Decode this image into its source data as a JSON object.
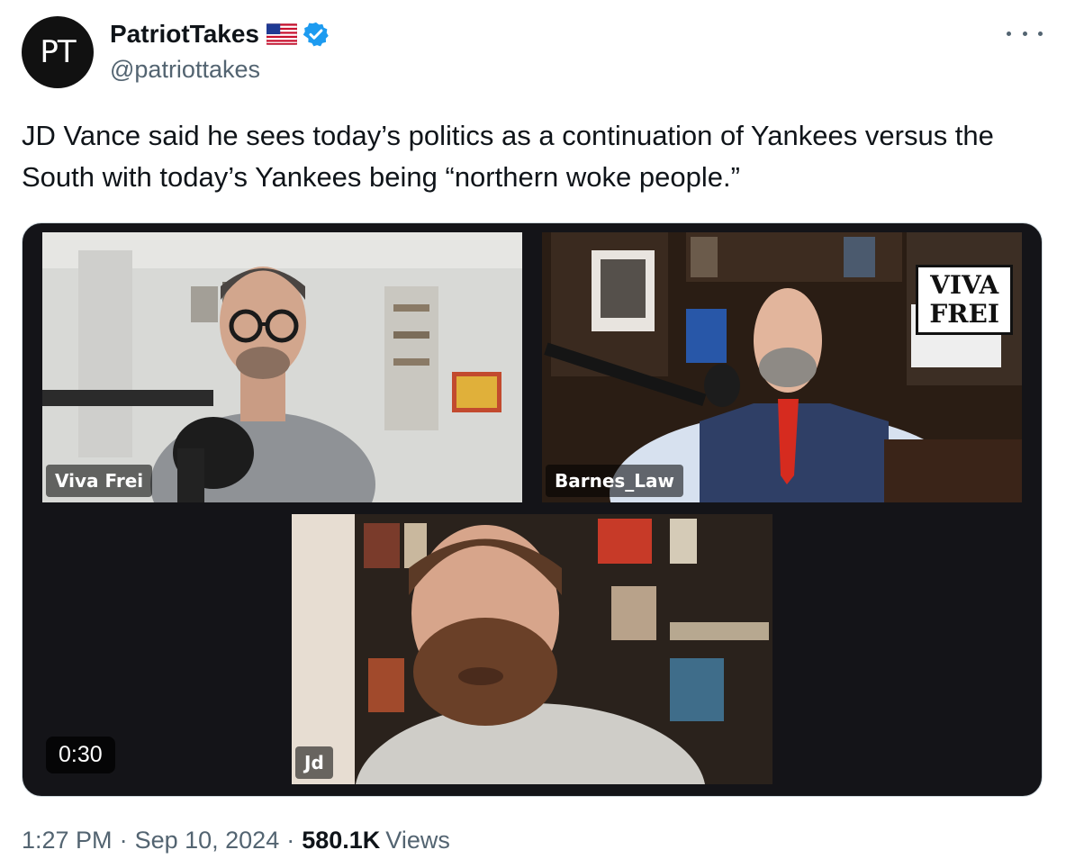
{
  "author": {
    "avatar_text": "PT",
    "display_name": "PatriotTakes",
    "handle": "@patriottakes",
    "verified": true,
    "flag": "us-flag-icon"
  },
  "tweet": {
    "text": "JD Vance said he sees today’s politics as a continuation of Yankees versus the South with today’s Yankees being “northern woke people.”"
  },
  "video": {
    "duration": "0:30",
    "watermark_line1": "VIVA",
    "watermark_line2": "FREI",
    "participants": [
      {
        "label": "Viva Frei"
      },
      {
        "label": "Barnes_Law"
      },
      {
        "label": "Jd"
      }
    ]
  },
  "meta": {
    "time": "1:27 PM",
    "date": "Sep 10, 2024",
    "views_count": "580.1K",
    "views_label": "Views"
  },
  "colors": {
    "text": "#0f1419",
    "secondary": "#536471",
    "verified_blue": "#1d9bf0",
    "border": "#cfd9de"
  }
}
